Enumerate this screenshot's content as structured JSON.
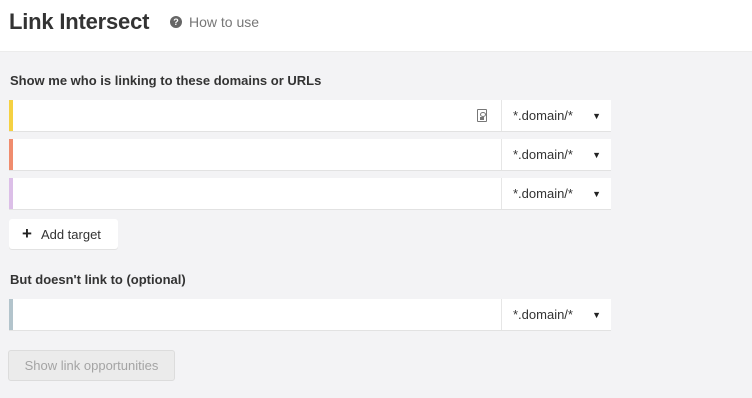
{
  "header": {
    "title": "Link Intersect",
    "help_icon": "question-circle-icon",
    "help_label": "How to use"
  },
  "targets_section": {
    "label": "Show me who is linking to these domains or URLs",
    "rows": [
      {
        "value": "",
        "mode": "*.domain/*",
        "accent_color": "#f5d142",
        "has_icon": true
      },
      {
        "value": "",
        "mode": "*.domain/*",
        "accent_color": "#f08c6e"
      },
      {
        "value": "",
        "mode": "*.domain/*",
        "accent_color": "#dcbfe8"
      }
    ],
    "add_label": "Add target",
    "add_icon": "plus-icon"
  },
  "exclude_section": {
    "label": "But doesn't link to (optional)",
    "row": {
      "value": "",
      "mode": "*.domain/*",
      "accent_color": "#b3c4cc"
    }
  },
  "submit_label": "Show link opportunities",
  "caret_glyph": "▼"
}
